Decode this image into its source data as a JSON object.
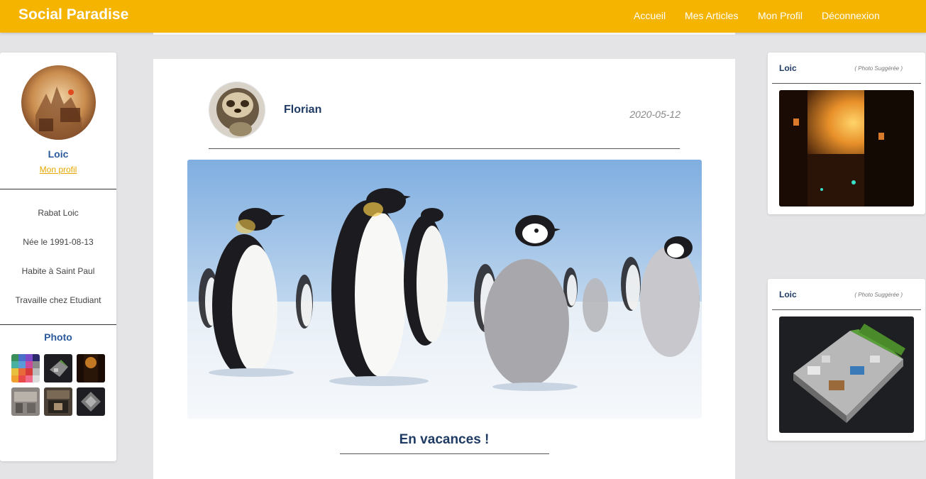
{
  "header": {
    "brand": "Social Paradise",
    "nav": [
      "Accueil",
      "Mes Articles",
      "Mon Profil",
      "Déconnexion"
    ],
    "accent_color": "#f4b400"
  },
  "sidebar": {
    "username": "Loic",
    "profile_link": "Mon profil",
    "info": [
      "Rabat Loic",
      "Née le 1991-08-13",
      "Habite à Saint Paul",
      "Travaille chez Etudiant"
    ],
    "photo_title": "Photo",
    "thumbnails": [
      "color-palette",
      "3d-house-plan",
      "fantasy-street",
      "interior-room",
      "interior-room-dark",
      "3d-house-plan-dark"
    ]
  },
  "post": {
    "author": "Florian",
    "date": "2020-05-12",
    "image": "penguins-on-ice",
    "title": "En vacances !"
  },
  "suggestions": [
    {
      "name": "Loic",
      "label": "( Photo Suggérée )",
      "image": "fantasy-street"
    },
    {
      "name": "Loic",
      "label": "( Photo Suggérée )",
      "image": "3d-house-plan"
    }
  ]
}
